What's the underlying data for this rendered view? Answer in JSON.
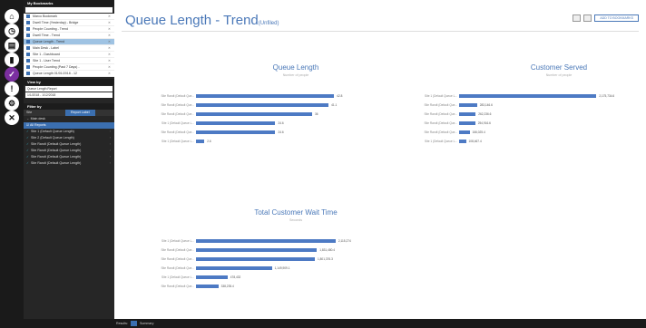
{
  "rail": [
    {
      "icon": "home-icon",
      "glyph": "⌂"
    },
    {
      "icon": "dashboard-icon",
      "glyph": "◷"
    },
    {
      "icon": "report-icon",
      "glyph": "▤"
    },
    {
      "icon": "chart-icon",
      "glyph": "▮"
    },
    {
      "icon": "check-icon",
      "glyph": "✓",
      "active": true
    },
    {
      "icon": "alert-icon",
      "glyph": "!"
    },
    {
      "icon": "settings-icon",
      "glyph": "⚙"
    },
    {
      "icon": "close-icon",
      "glyph": "✕"
    }
  ],
  "bookmarks": {
    "title": "My Bookmarks",
    "items": [
      "Marco Bookmark",
      "Dwell Time (Yesterday) - Bridge",
      "People Counting - Trend",
      "Dwell Time - Trend",
      "Queue Length - Trend",
      "Main Desk - Label",
      "Site 1 - Dashboard",
      "Site 1 - User Trend",
      "People Counting (Past 7 Days) - ",
      "Queue Length 01/01/2018 - 12"
    ],
    "selected": 4
  },
  "viewby": {
    "title": "View by",
    "report": "Queue Length Report",
    "date": "1/1/2018 - 1/12/2018"
  },
  "filter": {
    "title": "Filter by",
    "col1": "Site",
    "col2": "Report Label",
    "back": "Main desk",
    "all": "All Reports",
    "items": [
      "Site 1 (Default Queue Length)",
      "Site 2 (Default Queue Length)",
      "Site Randt (Default Queue Length)",
      "Site Randt (Default Queue Length)",
      "Site Randt (Default Queue Length)",
      "Site Randt (Default Queue Length)"
    ]
  },
  "main": {
    "title": "Queue Length - Trend",
    "title_small": "(Unfiled)",
    "add_bookmark": "ADD TO BOOKMARKS"
  },
  "bottom": {
    "text": "Results:",
    "tag": "Summary"
  },
  "chart_data": [
    {
      "type": "bar",
      "title": "Queue Length",
      "subtitle": "Number of people",
      "categories": [
        "Site Randt (Default Que...",
        "Site Randt (Default Que...",
        "Site Randt (Default Que...",
        "Site 1 (Default Queue L...",
        "Site Randt (Default Que...",
        "Site 1 (Default Queue L..."
      ],
      "values": [
        42.8,
        41.1,
        36,
        24.6,
        24.6,
        2.6
      ],
      "labels": [
        "42.8",
        "41.1",
        "36",
        "24.6",
        "24.6",
        "2.6"
      ],
      "max": 45
    },
    {
      "type": "bar",
      "title": "Customer Served",
      "subtitle": "Number of people",
      "categories": [
        "Site 1 (Default Queue L...",
        "Site Randt (Default Que...",
        "Site Randt (Default Que...",
        "Site Randt (Default Que...",
        "Site Randt (Default Que...",
        "Site 1 (Default Queue L..."
      ],
      "values": [
        2175734,
        283146,
        262236,
        254916,
        166025,
        108467
      ],
      "labels": [
        "2,175,734.6",
        "283,146.6",
        "262,236.6",
        "254,916.6",
        "166,025.4",
        "108,467.4"
      ],
      "max": 2300000
    },
    {
      "type": "bar",
      "title": "Total Customer Wait Time",
      "subtitle": "Seconds",
      "categories": [
        "Site 1 (Default Queue L...",
        "Site Randt (Default Que...",
        "Site Randt (Default Que...",
        "Site Randt (Default Que...",
        "Site 1 (Default Queue L...",
        "Site Randt (Default Que..."
      ],
      "values": [
        2115274,
        1831480,
        1801376,
        1149909,
        478432,
        338235
      ],
      "labels": [
        "2,115,274",
        "1,831,480.4",
        "1,801,376.3",
        "1,149,909.1",
        "478,432",
        "338,235.4"
      ],
      "max": 2200000
    }
  ]
}
